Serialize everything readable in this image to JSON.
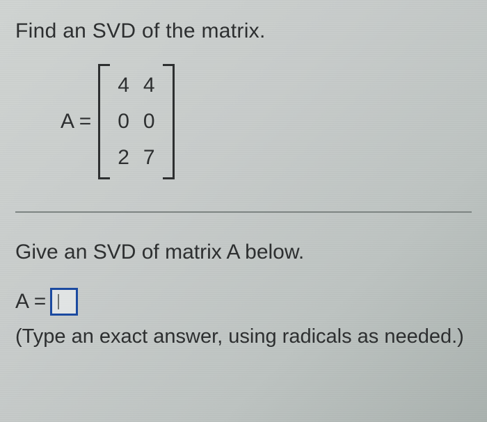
{
  "prompt": "Find an SVD of the matrix.",
  "matrix": {
    "label": "A =",
    "rows": [
      [
        "4",
        "4"
      ],
      [
        "0",
        "0"
      ],
      [
        "2",
        "7"
      ]
    ]
  },
  "question": "Give an SVD of matrix A below.",
  "answer": {
    "label": "A =",
    "value": ""
  },
  "hint": "(Type an exact answer, using radicals as needed.)"
}
